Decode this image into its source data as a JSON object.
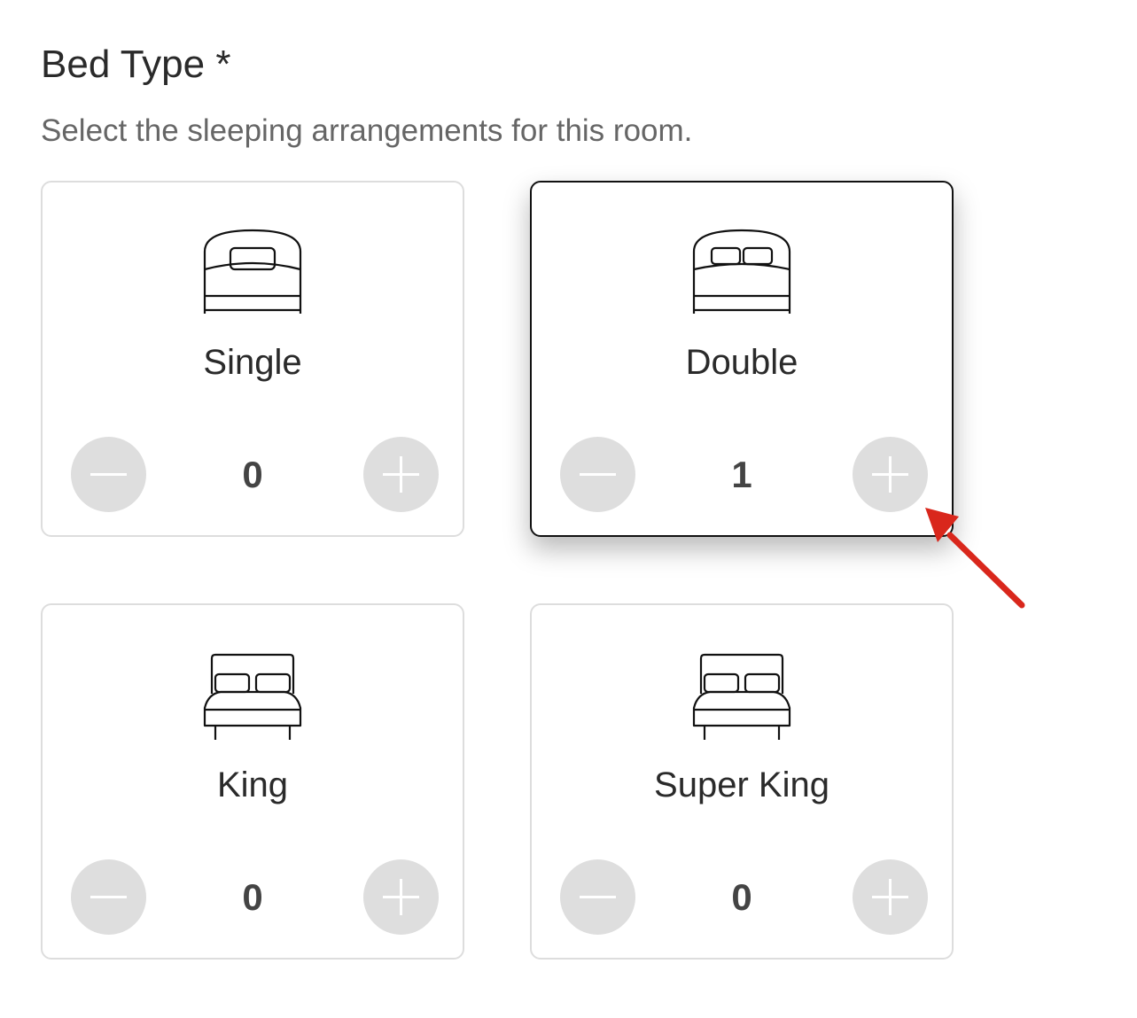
{
  "header": {
    "title": "Bed Type *",
    "subtitle": "Select the sleeping arrangements for this room."
  },
  "beds": [
    {
      "label": "Single",
      "count": "0",
      "icon": "single-bed-icon",
      "selected": false
    },
    {
      "label": "Double",
      "count": "1",
      "icon": "double-bed-icon",
      "selected": true
    },
    {
      "label": "King",
      "count": "0",
      "icon": "king-bed-icon",
      "selected": false
    },
    {
      "label": "Super King",
      "count": "0",
      "icon": "super-king-bed-icon",
      "selected": false
    }
  ],
  "colors": {
    "selected_border": "#111111",
    "card_border": "#dddddd",
    "stepper_bg": "#dedede",
    "annotation_arrow": "#d9271c"
  }
}
